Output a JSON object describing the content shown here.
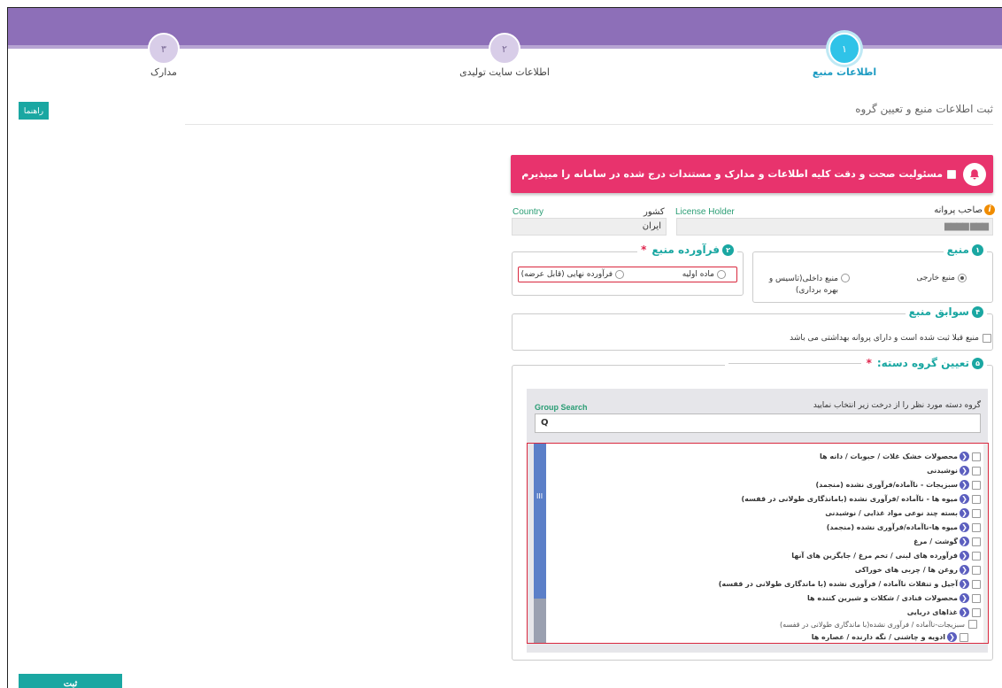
{
  "steps": [
    {
      "number": "۱",
      "label": "اطلاعات منبع"
    },
    {
      "number": "۲",
      "label": "اطلاعات سایت تولیدی"
    },
    {
      "number": "۳",
      "label": "مدارک"
    }
  ],
  "guide_button": "راهنما",
  "page_title": "ثبت اطلاعات منبع و تعیین گروه",
  "alert": {
    "text": "مسئولیت صحت و دقت کلیه اطلاعات و مدارک و مستندات درج شده در سامانه را میپذیرم"
  },
  "license_holder": {
    "label": "صاحب پروانه",
    "label_en": "License Holder",
    "info_icon": "i",
    "value": "▆▆▆ ▆▆▆▆"
  },
  "country": {
    "label": "کشور",
    "label_en": "Country",
    "value": "ایران"
  },
  "source_box": {
    "number": "۱",
    "title": "منبع",
    "options": [
      "منبع خارجی",
      "منبع داخلی(تاسیس و بهره برداری)"
    ],
    "selected": "منبع خارجی"
  },
  "product_box": {
    "number": "۲",
    "title": "فرآورده منبع",
    "required_mark": "*",
    "options": [
      "ماده اولیه",
      "فرآورده نهایی (قابل عرضه)"
    ]
  },
  "history_box": {
    "number": "۴",
    "title": "سوابق منبع",
    "checkbox_label": "منبع قبلا ثبت شده است و دارای پروانه بهداشتی می باشد"
  },
  "group_box": {
    "number": "۵",
    "title": "تعیین گروه دسته:",
    "required_mark": "*",
    "instruction": "گروه دسته مورد نظر را از درخت زیر انتخاب نمایید",
    "search_label": "Group Search",
    "search_icon": "Q",
    "scroll_grip": "III",
    "items": [
      "محصولات خشک غلات / حبوبات / دانه ها",
      "نوشیدنی",
      "سبزیجات - ناآماده/فرآوری نشده (منجمد)",
      "میوه ها - ناآماده /فرآوری نشده (بامانذگاری طولانی در قفسه)",
      "بسته چند نوعی مواد غذایی / نوشیدنی",
      "میوه ها-ناآماده/فرآوری نشده (منجمد)",
      "گوشت / مرغ",
      "فرآورده های لبنی / تخم مرغ / جایگزین های آنها",
      "روغن ها / چربی های خوراکی",
      "آجیل و تنقلات ناآماده / فرآوری نشده (با ماندگاری طولانی در قفسه)",
      "محصولات قنادی / شکلات و شیرین کننده ها",
      "غذاهای دریایی"
    ],
    "sub_item": "سبزیجات-ناآماده / فرآوری نشده(با ماندگاری طولانی در قفسه)",
    "sub_sub_item": "ادویه و چاشنی / نگه دارنده / عصاره ها"
  },
  "submit_button": "ثبت"
}
